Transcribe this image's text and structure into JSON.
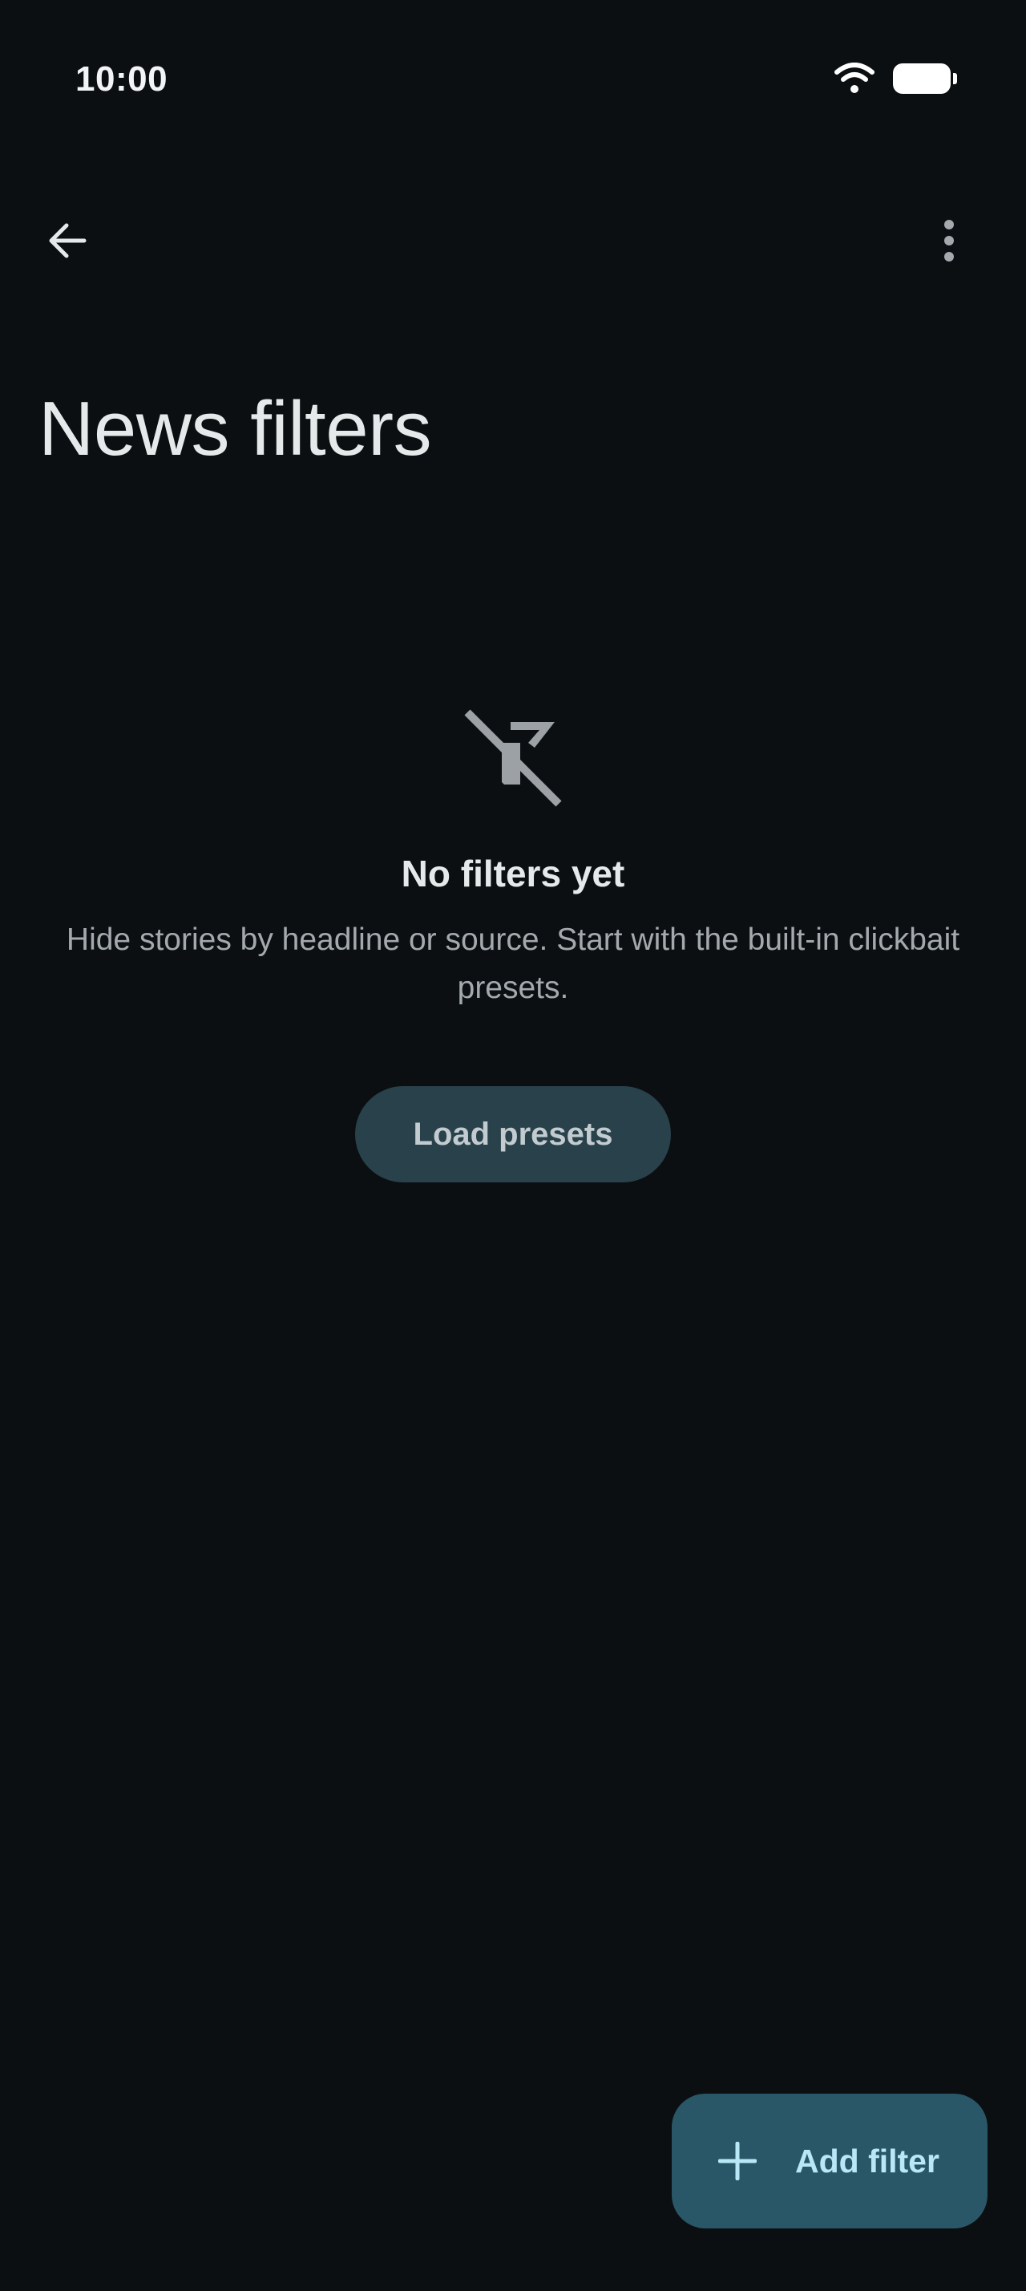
{
  "status_bar": {
    "time": "10:00",
    "icons": [
      "wifi-icon",
      "battery-icon"
    ]
  },
  "top_bar": {
    "back_icon": "arrow-back-icon",
    "more_icon": "more-vert-icon"
  },
  "page": {
    "title": "News filters"
  },
  "empty_state": {
    "icon": "filter-off-icon",
    "title": "No filters yet",
    "description": "Hide stories by headline or source. Start with the built-in clickbait presets.",
    "button_label": "Load presets"
  },
  "fab": {
    "icon": "plus-icon",
    "label": "Add filter"
  },
  "colors": {
    "background": "#0b0f12",
    "secondary_button": "#29414a",
    "fab_background": "#2a5767",
    "fab_text": "#b8e7f6"
  }
}
